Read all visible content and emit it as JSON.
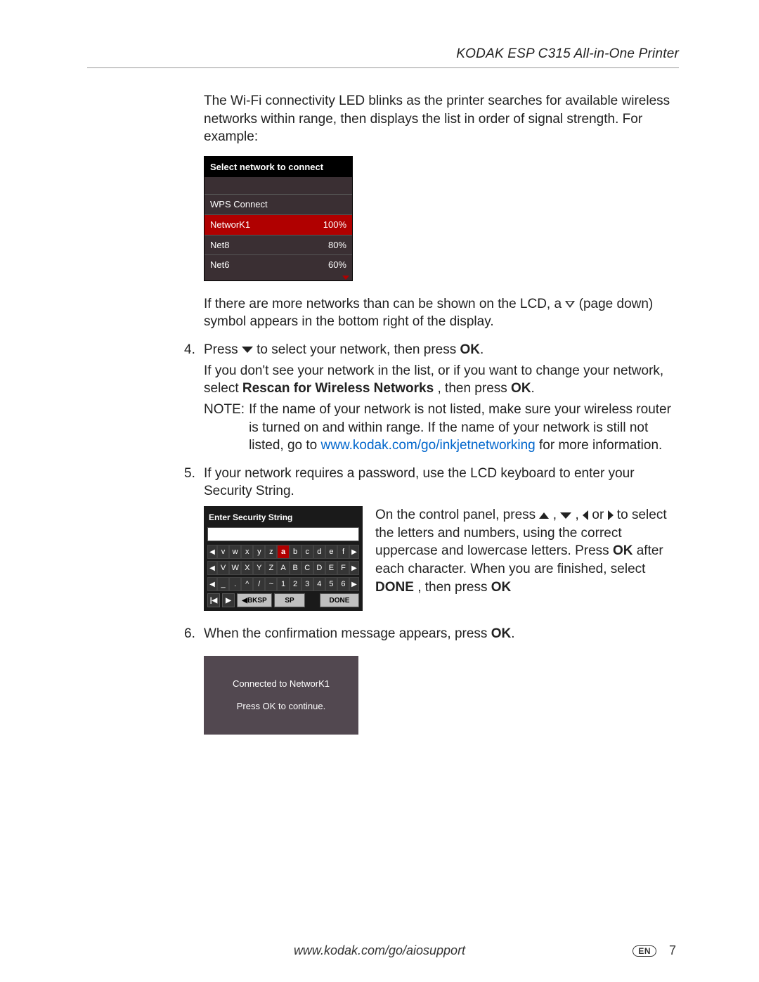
{
  "header": {
    "title": "KODAK ESP C315 All-in-One Printer"
  },
  "intro": "The Wi-Fi connectivity LED blinks as the printer searches for available wireless networks within range, then displays the list in order of signal strength. For example:",
  "lcd_networks": {
    "title": "Select network to connect",
    "rows": [
      {
        "name": "WPS Connect",
        "signal": ""
      },
      {
        "name": "NetworK1",
        "signal": "100%",
        "selected": true
      },
      {
        "name": "Net8",
        "signal": "80%"
      },
      {
        "name": "Net6",
        "signal": "60%"
      }
    ]
  },
  "after_lcd_a": "If there are more networks than can be shown on the LCD, a ",
  "after_lcd_b": " (page down) symbol appears in the bottom right of the display.",
  "step4": {
    "a": "Press ",
    "b": " to select your network, then press ",
    "ok": "OK",
    "c": ".",
    "line2a": "If you don't see your network in the list, or if you want to change your network, select ",
    "rescan": "Rescan for Wireless Networks",
    "line2b": ", then press ",
    "line2c": ".",
    "note_label": "NOTE:",
    "note_a": "If the name of your network is not listed, make sure your wireless router is turned on and within range. If the name of your network is still not listed, go to ",
    "note_link": "www.kodak.com/go/inkjetnetworking",
    "note_b": " for more information."
  },
  "step5": {
    "text": "If your network requires a password, use the LCD keyboard to enter your Security String.",
    "kb_title": "Enter Security String",
    "kb_rows": {
      "r1": [
        "v",
        "w",
        "x",
        "y",
        "z",
        "a",
        "b",
        "c",
        "d",
        "e",
        "f"
      ],
      "r1_hot_index": 5,
      "r2": [
        "V",
        "W",
        "X",
        "Y",
        "Z",
        "A",
        "B",
        "C",
        "D",
        "E",
        "F"
      ],
      "r3": [
        "_",
        ".",
        "^",
        "/",
        "~",
        "1",
        "2",
        "3",
        "4",
        "5",
        "6"
      ]
    },
    "kb_buttons": {
      "bksp": "◀BKSP",
      "sp": "SP",
      "done": "DONE"
    },
    "side_a": "On the control panel, press ",
    "side_b": ", ",
    "side_c": ", ",
    "side_d": " or ",
    "side_e": " to select the letters and numbers, using the correct uppercase and lowercase letters. Press ",
    "side_f": " after each character. When you are finished, select ",
    "done_bold": "DONE",
    "side_g": ", then press ",
    "ok": "OK"
  },
  "step6": {
    "a": "When the confirmation message appears, press ",
    "ok": "OK",
    "b": "."
  },
  "lcd_confirm": {
    "line1": "Connected to NetworK1",
    "line2": "Press OK to continue."
  },
  "footer": {
    "url": "www.kodak.com/go/aiosupport",
    "lang": "EN",
    "pagenum": "7"
  }
}
